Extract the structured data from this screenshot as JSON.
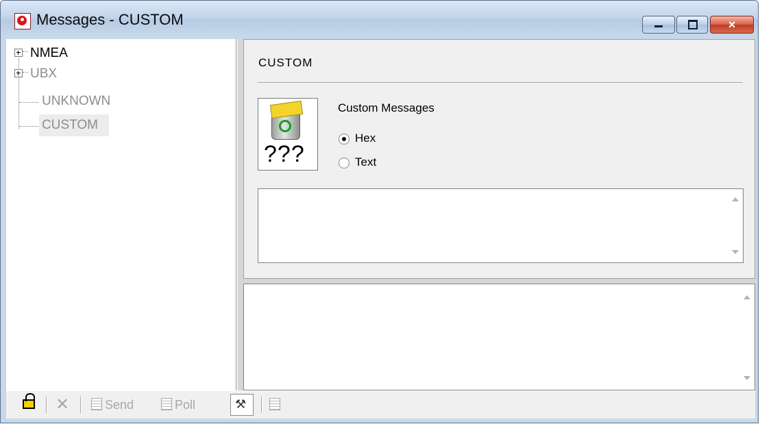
{
  "window": {
    "title": "Messages - CUSTOM",
    "controls": {
      "minimize": "minimize",
      "maximize": "maximize",
      "close": "×"
    }
  },
  "tree": {
    "items": [
      {
        "label": "NMEA",
        "expandable": true,
        "enabled": true
      },
      {
        "label": "UBX",
        "expandable": true,
        "enabled": false
      },
      {
        "label": "UNKNOWN",
        "expandable": false,
        "enabled": false
      },
      {
        "label": "CUSTOM",
        "expandable": false,
        "enabled": false,
        "selected": true
      }
    ]
  },
  "custom_panel": {
    "section_title": "CUSTOM",
    "icon_text": "???",
    "icon": "recycle-bin-icon",
    "description": "Custom Messages",
    "format_options": [
      {
        "label": "Hex",
        "checked": true
      },
      {
        "label": "Text",
        "checked": false
      }
    ],
    "message_input_value": "",
    "output_value": ""
  },
  "toolbar": {
    "send_label": "Send",
    "poll_label": "Poll",
    "icons": [
      "lock-icon",
      "delete-icon",
      "send-icon",
      "poll-icon",
      "custom-tool-icon",
      "copy-icon"
    ]
  }
}
